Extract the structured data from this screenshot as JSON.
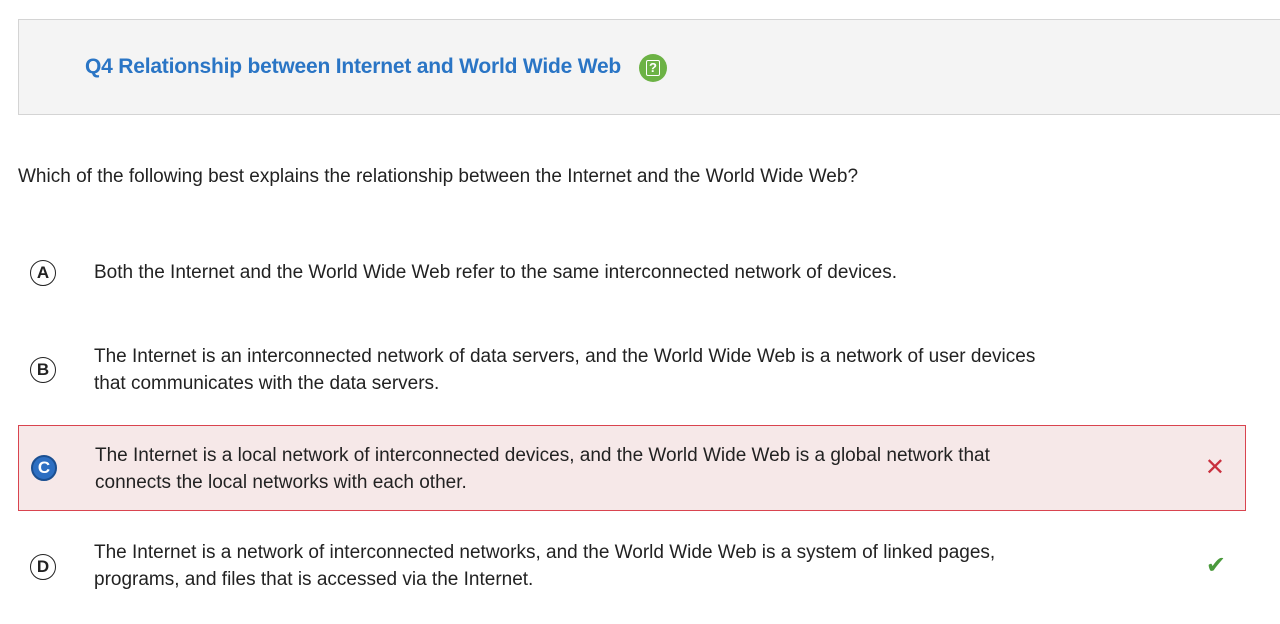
{
  "header": {
    "title": "Q4 Relationship between Internet and World Wide Web",
    "help_glyph": "?",
    "help_color": "#6cb245",
    "title_color": "#2a75c5"
  },
  "question": {
    "text": "Which of the following best explains the relationship between the Internet and the World Wide Web?"
  },
  "options": [
    {
      "letter": "A",
      "text": "Both the Internet and the World Wide Web refer to the same interconnected network of devices.",
      "selected": false,
      "status": "none"
    },
    {
      "letter": "B",
      "text": "The Internet is an interconnected network of data servers, and the World Wide Web is a network of user devices that communicates with the data servers.",
      "selected": false,
      "status": "none"
    },
    {
      "letter": "C",
      "text": "The Internet is a local network of interconnected devices, and the World Wide Web is a global network that connects the local networks with each other.",
      "selected": true,
      "status": "incorrect",
      "status_glyph": "✕"
    },
    {
      "letter": "D",
      "text": "The Internet is a network of interconnected networks, and the World Wide Web is a system of linked pages, programs, and files that is accessed via the Internet.",
      "selected": false,
      "status": "correct",
      "status_glyph": "✔"
    }
  ],
  "colors": {
    "wrong": "#c9303e",
    "right": "#4a9a3c",
    "selected_bg": "#f6e8e8",
    "selected_border": "#d9444f",
    "chosen_letter_bg": "#2d6fc2"
  }
}
